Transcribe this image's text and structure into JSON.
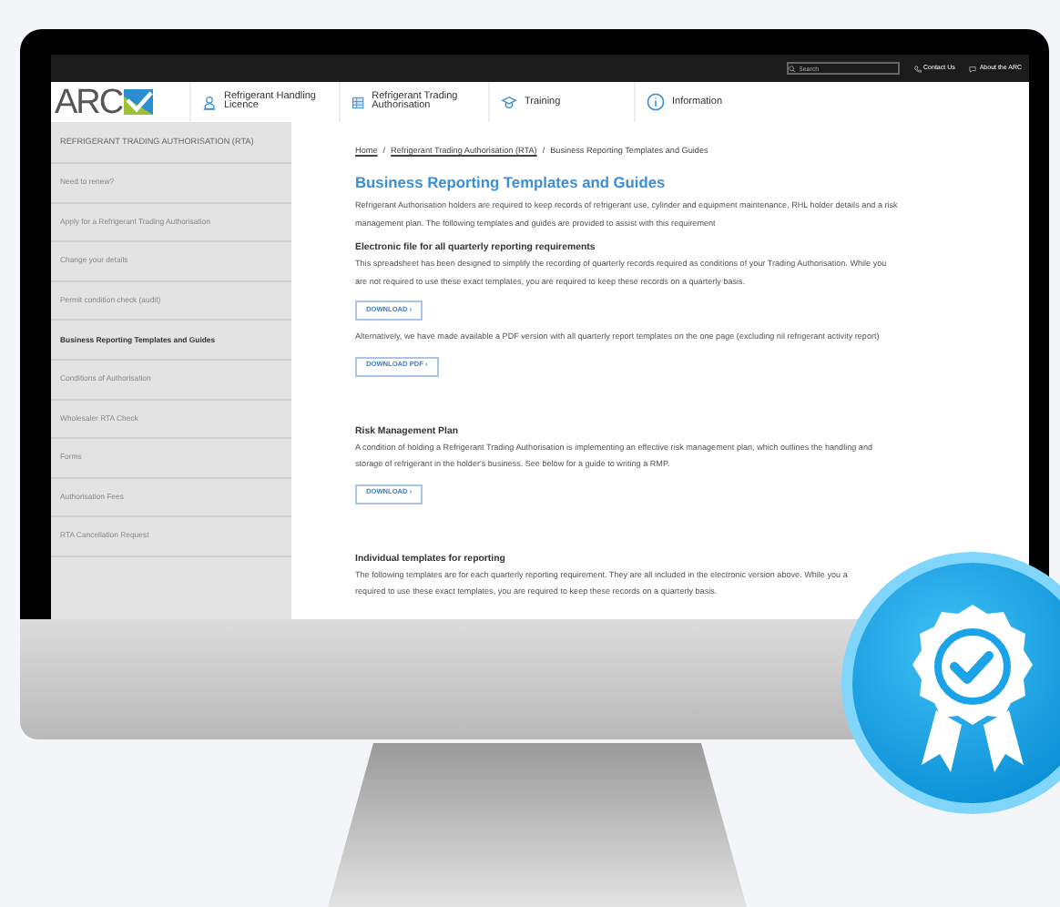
{
  "top_bar": {
    "search": {
      "placeholder": "Search"
    },
    "links": [
      {
        "kind": "phone",
        "label": "Contact Us"
      },
      {
        "kind": "chat",
        "label": "About the ARC"
      }
    ]
  },
  "logo": {
    "text": "ARC"
  },
  "nav": [
    {
      "kind": "licence",
      "label": "Refrigerant Handling Licence"
    },
    {
      "kind": "authorisation",
      "label": "Refrigerant Trading Authorisation"
    },
    {
      "kind": "training",
      "label": "Training"
    },
    {
      "kind": "information",
      "label": "Information"
    }
  ],
  "sidebar": {
    "title": "REFRIGERANT TRADING AUTHORISATION (RTA)",
    "items": [
      {
        "label": "Need to renew?",
        "selected": false
      },
      {
        "label": "Apply for a Refrigerant Trading Authorisation",
        "selected": false
      },
      {
        "label": "Change your details",
        "selected": false
      },
      {
        "label": "Permit condition check (audit)",
        "selected": false
      },
      {
        "label": "Business Reporting Templates and Guides",
        "selected": true
      },
      {
        "label": "Conditions of Authorisation",
        "selected": false
      },
      {
        "label": "Wholesaler RTA Check",
        "selected": false
      },
      {
        "label": "Forms",
        "selected": false
      },
      {
        "label": "Authorisation Fees",
        "selected": false
      },
      {
        "label": "RTA Cancellation Request",
        "selected": false
      }
    ]
  },
  "breadcrumb": [
    {
      "kind": "link",
      "label": "Home"
    },
    {
      "kind": "separator",
      "label": "/"
    },
    {
      "kind": "link",
      "label": "Refrigerant Trading Authorisation (RTA)"
    },
    {
      "kind": "separator",
      "label": "/"
    },
    {
      "kind": "current",
      "label": "Business Reporting Templates and Guides"
    }
  ],
  "heading": "Business Reporting Templates and Guides",
  "blocks": [
    {
      "kind": "paragraph",
      "lines": [
        "Refrigerant Authorisation holders are required to keep records of refrigerant use, cylinder and equipment maintenance, RHL holder details and a risk",
        "management plan. The following templates and guides are provided to assist with this requirement"
      ]
    },
    {
      "kind": "subheading",
      "text": "Electronic file for all quarterly reporting requirements"
    },
    {
      "kind": "paragraph",
      "lines": [
        "This spreadsheet has been designed to simplify the recording of quarterly records required as conditions of your Trading Authorisation. While you",
        "are not required to use these exact templates, you are required to keep these records on a quarterly basis."
      ]
    },
    {
      "kind": "button",
      "text": "DOWNLOAD ›"
    },
    {
      "kind": "paragraph",
      "lines": [
        "Alternatively, we have made available a PDF version with all quarterly report templates on the one page (excluding nil refrigerant activity report)"
      ]
    },
    {
      "kind": "button",
      "text": "DOWNLOAD PDF ›"
    },
    {
      "kind": "gap"
    },
    {
      "kind": "subheading",
      "text": "Risk Management Plan"
    },
    {
      "kind": "paragraph",
      "lines": [
        "A condition of holding a Refrigerant Trading Authorisation is implementing an effective risk management plan, which outlines the handling and",
        "storage of refrigerant in the holder's business. See below for a guide to writing a RMP."
      ]
    },
    {
      "kind": "button",
      "text": "DOWNLOAD ›"
    },
    {
      "kind": "gap"
    },
    {
      "kind": "subheading",
      "text": "Individual templates for reporting"
    },
    {
      "kind": "paragraph",
      "lines": [
        "The following templates are for each quarterly reporting requirement. They are all included in the electronic version above. While you a",
        "required to use these exact templates, you are required to keep these records on a quarterly basis."
      ]
    }
  ]
}
